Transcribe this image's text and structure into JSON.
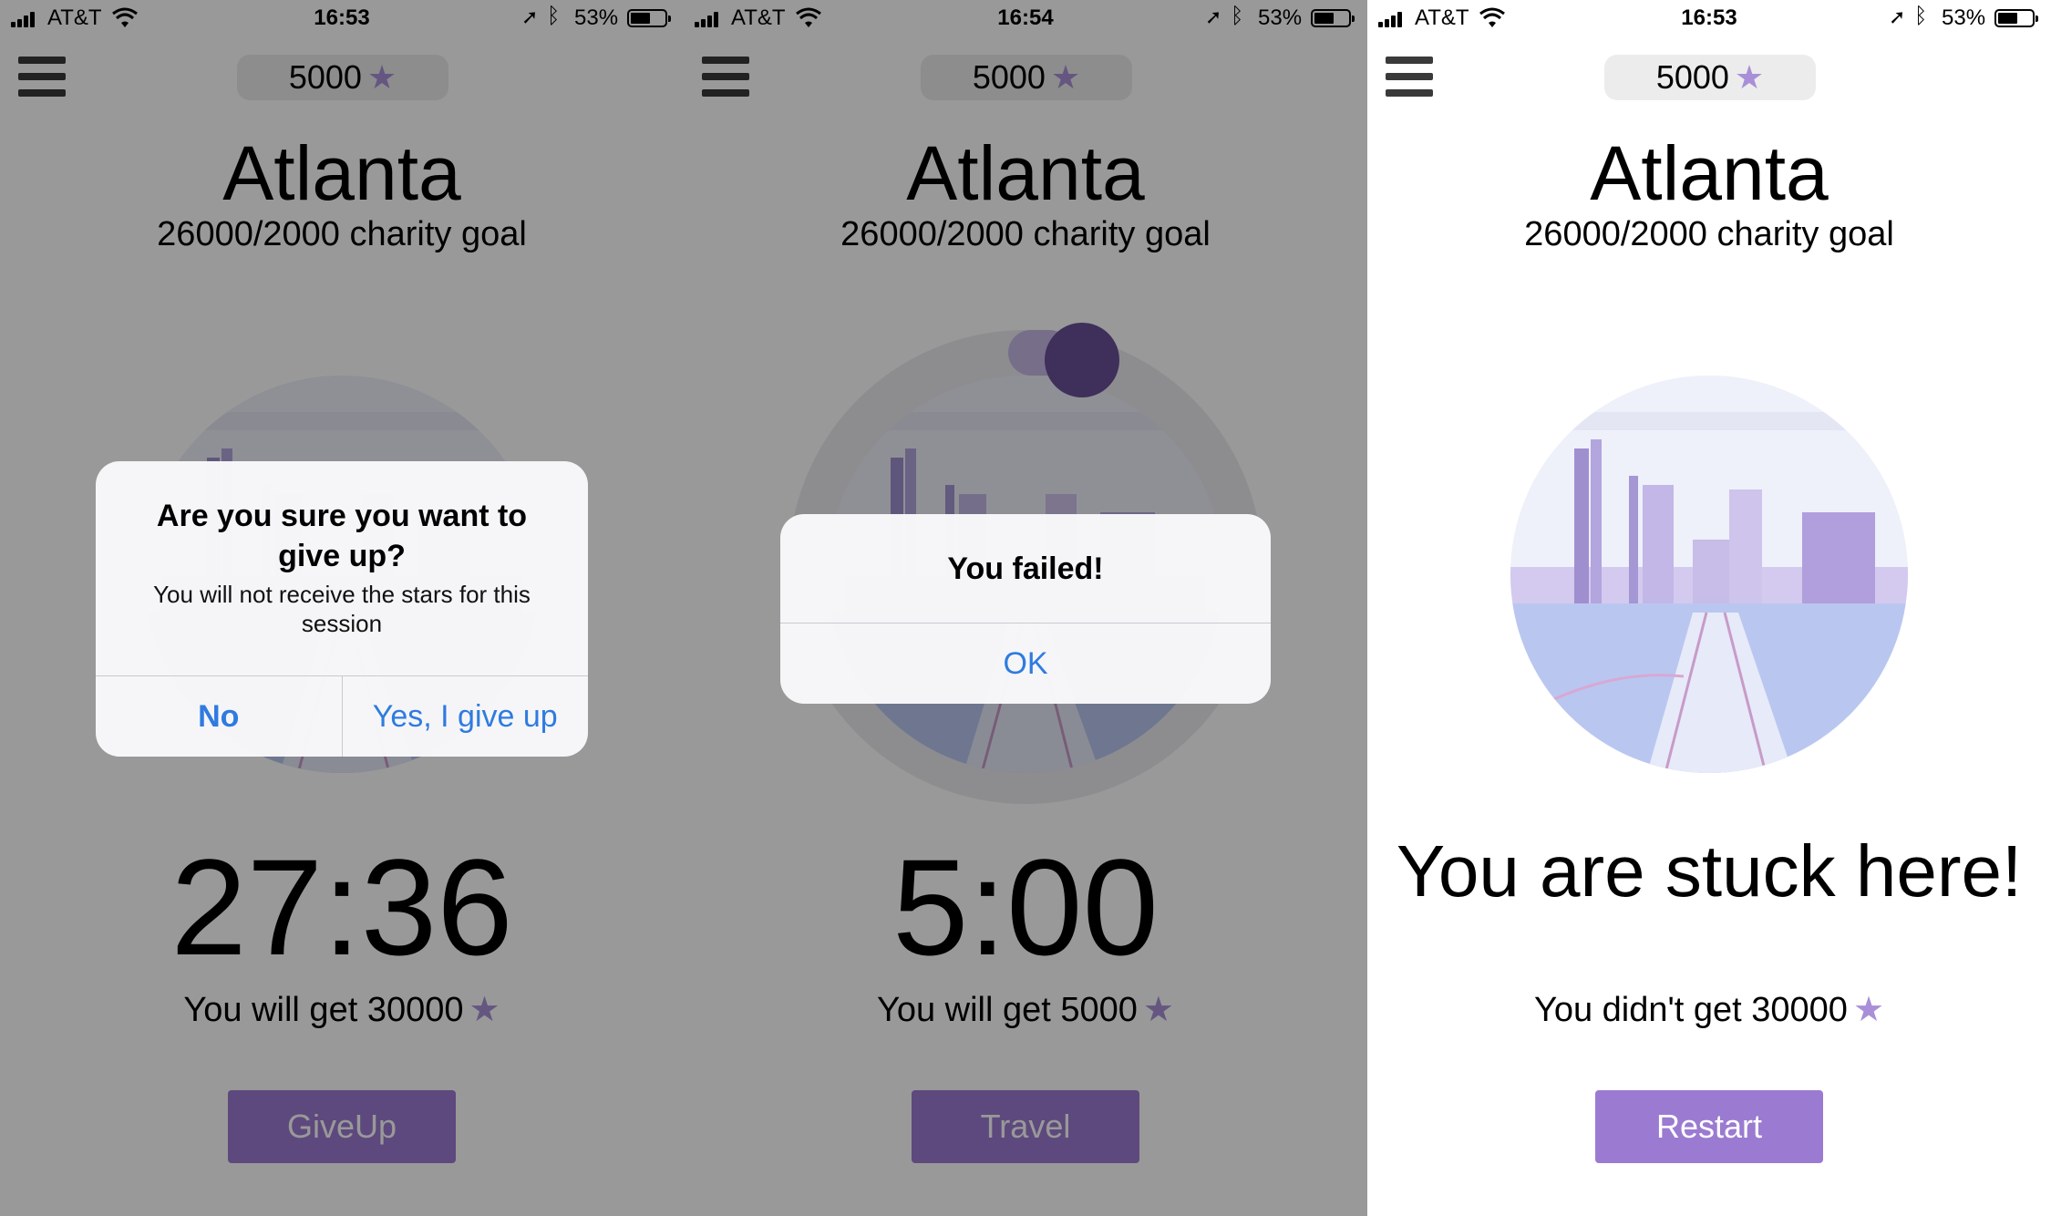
{
  "status_bars": [
    {
      "carrier": "AT&T",
      "time": "16:53",
      "battery": "53%"
    },
    {
      "carrier": "AT&T",
      "time": "16:54",
      "battery": "53%"
    },
    {
      "carrier": "AT&T",
      "time": "16:53",
      "battery": "53%"
    }
  ],
  "screens": [
    {
      "stars": "5000",
      "city": "Atlanta",
      "goal": "26000/2000 charity goal",
      "timer": "27:36",
      "reward_text": "You will get 30000",
      "button": "GiveUp",
      "alert": {
        "title": "Are you sure you want to give up?",
        "message": "You will not receive the stars for this session",
        "buttons": [
          "No",
          "Yes, I give up"
        ]
      }
    },
    {
      "stars": "5000",
      "city": "Atlanta",
      "goal": "26000/2000 charity goal",
      "timer": "5:00",
      "reward_text": "You will get 5000",
      "button": "Travel",
      "alert": {
        "title": "You failed!",
        "buttons": [
          "OK"
        ]
      }
    },
    {
      "stars": "5000",
      "city": "Atlanta",
      "goal": "26000/2000 charity goal",
      "message": "You are stuck here!",
      "reward_text": "You didn't get 30000",
      "button": "Restart"
    }
  ],
  "colors": {
    "accent": "#9b7bd1",
    "star": "#a98fd7",
    "alert_button": "#2f7be0",
    "dim_overlay": "rgba(0,0,0,0.40)"
  },
  "icons": [
    "menu-icon",
    "star-icon",
    "signal-icon",
    "wifi-icon",
    "location-icon",
    "bluetooth-icon",
    "battery-icon"
  ]
}
